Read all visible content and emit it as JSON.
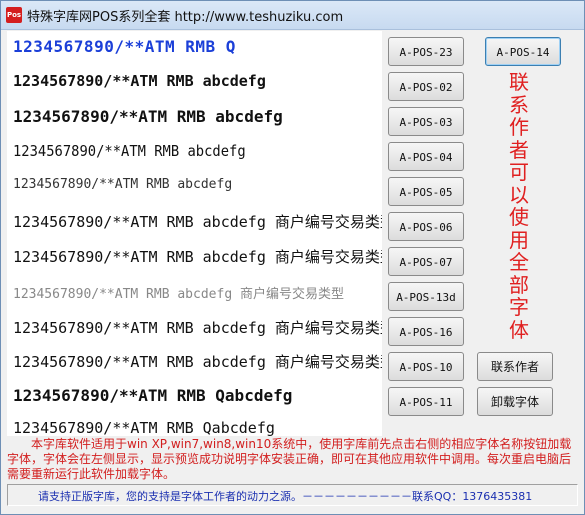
{
  "window": {
    "title": "特殊字库网POS系列全套  http://www.teshuziku.com",
    "icon_label": "Pos"
  },
  "preview_lines": [
    "1234567890/**ATM RMB Q",
    "1234567890/**ATM RMB abcdefg",
    "1234567890/**ATM RMB abcdefg",
    "1234567890/**ATM RMB abcdefg",
    "1234567890/**ATM RMB abcdefg",
    "1234567890/**ATM RMB abcdefg 商户编号交易类型",
    "1234567890/**ATM RMB abcdefg 商户编号交易类型",
    "1234567890/**ATM RMB abcdefg 商户编号交易类型",
    "1234567890/**ATM RMB abcdefg 商户编号交易类型",
    "1234567890/**ATM RMB abcdefg 商户编号交易类型",
    "1234567890/**ATM RMB Qabcdefg",
    "1234567890/**ATM RMB Qabcdefg"
  ],
  "font_buttons_left": [
    "A-POS-23",
    "A-POS-02",
    "A-POS-03",
    "A-POS-04",
    "A-POS-05",
    "A-POS-06",
    "A-POS-07",
    "A-POS-13d",
    "A-POS-16",
    "A-POS-10",
    "A-POS-11"
  ],
  "font_button_right": "A-POS-14",
  "vertical_note": "联系作者可以使用全部字体",
  "contact_button": "联系作者",
  "uninstall_button": "卸载字体",
  "notice": "本字库软件适用于win XP,win7,win8,win10系统中，使用字库前先点击右侧的相应字体名称按钮加载字体，字体会在左侧显示，显示预览成功说明字体安装正确，即可在其他应用软件中调用。每次重启电脑后需要重新运行此软件加载字体。",
  "status": "请支持正版字库，您的支持是字体工作者的动力之源。－－－－－－－－－－联系QQ：1376435381",
  "colors": {
    "accent_blue": "#1b3fd8",
    "notice_red": "#d21e1e",
    "note_red": "#e02020"
  }
}
